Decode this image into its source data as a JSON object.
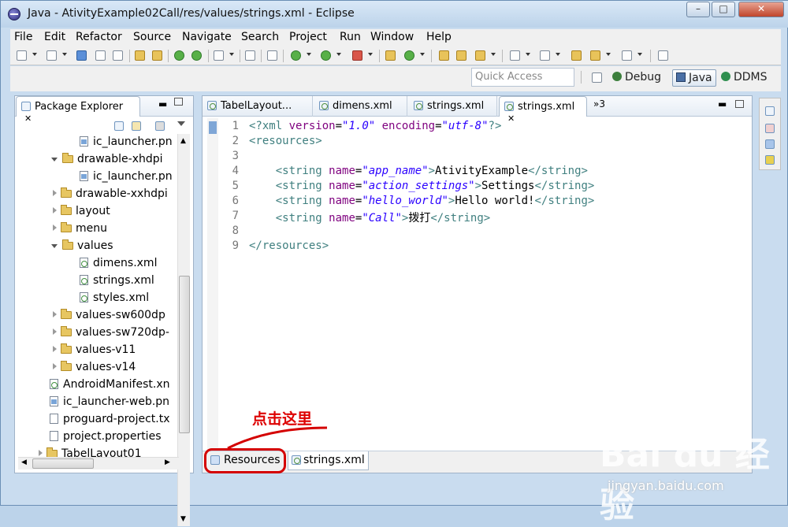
{
  "window": {
    "title": "Java - AtivityExample02Call/res/values/strings.xml - Eclipse",
    "controls": [
      "–",
      "□",
      "✕"
    ]
  },
  "menu": [
    "File",
    "Edit",
    "Refactor",
    "Source",
    "Navigate",
    "Search",
    "Project",
    "Run",
    "Window",
    "Help"
  ],
  "perspective_bar": {
    "quick_access_placeholder": "Quick Access",
    "debug": "Debug",
    "java": "Java",
    "ddms": "DDMS"
  },
  "package_explorer": {
    "tab_label": "Package Explorer",
    "tab_close": "✕",
    "items": [
      {
        "label": "ic_launcher.pn",
        "kind": "png",
        "indent": 1
      },
      {
        "label": "drawable-xhdpi",
        "kind": "folder",
        "state": "open",
        "indent": 0
      },
      {
        "label": "ic_launcher.pn",
        "kind": "png",
        "indent": 1
      },
      {
        "label": "drawable-xxhdpi",
        "kind": "folder",
        "state": "closed",
        "indent": 0
      },
      {
        "label": "layout",
        "kind": "folder",
        "state": "closed",
        "indent": 0
      },
      {
        "label": "menu",
        "kind": "folder",
        "state": "closed",
        "indent": 0
      },
      {
        "label": "values",
        "kind": "folder",
        "state": "open",
        "indent": 0
      },
      {
        "label": "dimens.xml",
        "kind": "xml",
        "indent": 1
      },
      {
        "label": "strings.xml",
        "kind": "xml",
        "indent": 1
      },
      {
        "label": "styles.xml",
        "kind": "xml",
        "indent": 1
      },
      {
        "label": "values-sw600dp",
        "kind": "folder",
        "state": "closed",
        "indent": 0
      },
      {
        "label": "values-sw720dp-",
        "kind": "folder",
        "state": "closed",
        "indent": 0
      },
      {
        "label": "values-v11",
        "kind": "folder",
        "state": "closed",
        "indent": 0
      },
      {
        "label": "values-v14",
        "kind": "folder",
        "state": "closed",
        "indent": 0
      },
      {
        "label": "AndroidManifest.xn",
        "kind": "xml",
        "indent": -1
      },
      {
        "label": "ic_launcher-web.pn",
        "kind": "png",
        "indent": -1
      },
      {
        "label": "proguard-project.tx",
        "kind": "file",
        "indent": -1
      },
      {
        "label": "project.properties",
        "kind": "file",
        "indent": -1
      },
      {
        "label": "TabelLayout01",
        "kind": "project",
        "indent": -2
      }
    ]
  },
  "editor_tabs": {
    "tabs": [
      "TabelLayout...",
      "dimens.xml",
      "strings.xml",
      "strings.xml"
    ],
    "active_close": "✕",
    "overflow": "»3"
  },
  "code": {
    "line_numbers": [
      "1",
      "2",
      "3",
      "4",
      "5",
      "6",
      "7",
      "8",
      "9"
    ],
    "lines": [
      [
        {
          "t": "tag",
          "s": "<?xml "
        },
        {
          "t": "attr",
          "s": "version"
        },
        {
          "t": "txt",
          "s": "="
        },
        {
          "t": "val",
          "s": "\"1.0\""
        },
        {
          "t": "txt",
          "s": " "
        },
        {
          "t": "attr",
          "s": "encoding"
        },
        {
          "t": "txt",
          "s": "="
        },
        {
          "t": "val",
          "s": "\"utf-8\""
        },
        {
          "t": "tag",
          "s": "?>"
        }
      ],
      [
        {
          "t": "tag",
          "s": "<resources>"
        }
      ],
      [],
      [
        {
          "t": "txt",
          "s": "    "
        },
        {
          "t": "tag",
          "s": "<string "
        },
        {
          "t": "attr",
          "s": "name"
        },
        {
          "t": "txt",
          "s": "="
        },
        {
          "t": "val",
          "s": "\"app_name\""
        },
        {
          "t": "tag",
          "s": ">"
        },
        {
          "t": "txt",
          "s": "AtivityExample"
        },
        {
          "t": "tag",
          "s": "</string>"
        }
      ],
      [
        {
          "t": "txt",
          "s": "    "
        },
        {
          "t": "tag",
          "s": "<string "
        },
        {
          "t": "attr",
          "s": "name"
        },
        {
          "t": "txt",
          "s": "="
        },
        {
          "t": "val",
          "s": "\"action_settings\""
        },
        {
          "t": "tag",
          "s": ">"
        },
        {
          "t": "txt",
          "s": "Settings"
        },
        {
          "t": "tag",
          "s": "</string>"
        }
      ],
      [
        {
          "t": "txt",
          "s": "    "
        },
        {
          "t": "tag",
          "s": "<string "
        },
        {
          "t": "attr",
          "s": "name"
        },
        {
          "t": "txt",
          "s": "="
        },
        {
          "t": "val",
          "s": "\"hello_world\""
        },
        {
          "t": "tag",
          "s": ">"
        },
        {
          "t": "txt",
          "s": "Hello world!"
        },
        {
          "t": "tag",
          "s": "</string>"
        }
      ],
      [
        {
          "t": "txt",
          "s": "    "
        },
        {
          "t": "tag",
          "s": "<string "
        },
        {
          "t": "attr",
          "s": "name"
        },
        {
          "t": "txt",
          "s": "="
        },
        {
          "t": "val",
          "s": "\"Call\""
        },
        {
          "t": "tag",
          "s": ">"
        },
        {
          "t": "txt",
          "s": "拨打"
        },
        {
          "t": "tag",
          "s": "</string>"
        }
      ],
      [],
      [
        {
          "t": "tag",
          "s": "</resources>"
        }
      ]
    ]
  },
  "bottom_tabs": {
    "resources": "Resources",
    "source": "strings.xml"
  },
  "annotation": {
    "text": "点击这里",
    "color": "#dd0000"
  },
  "watermark": {
    "main": "Bai du 经验",
    "sub": "jingyan.baidu.com"
  }
}
